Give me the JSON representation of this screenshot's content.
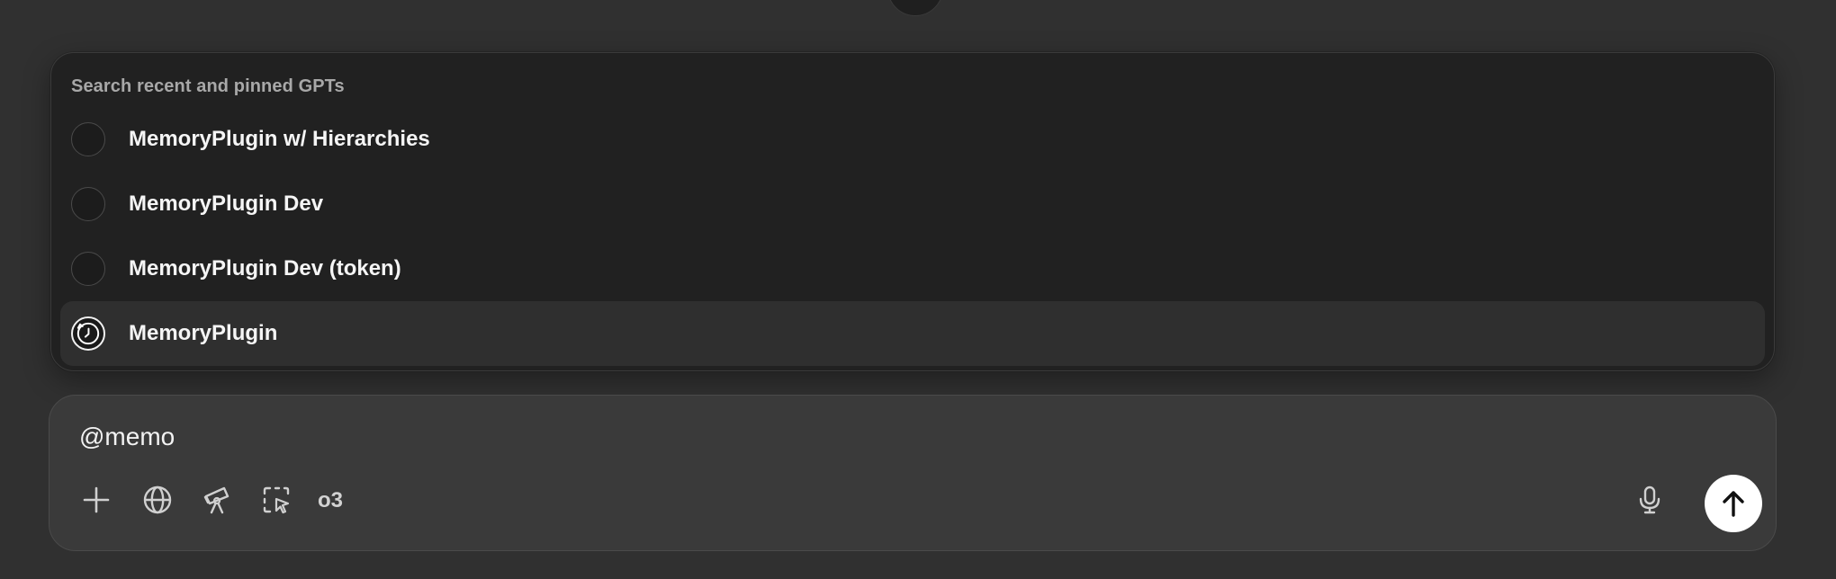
{
  "popup": {
    "heading": "Search recent and pinned GPTs",
    "items": [
      {
        "label": "MemoryPlugin w/ Hierarchies",
        "avatar": "empty-circle-avatar",
        "active": false
      },
      {
        "label": "MemoryPlugin Dev",
        "avatar": "empty-circle-avatar",
        "active": false
      },
      {
        "label": "MemoryPlugin Dev (token)",
        "avatar": "empty-circle-avatar",
        "active": false
      },
      {
        "label": "MemoryPlugin",
        "avatar": "clock-logo-avatar",
        "active": true
      }
    ]
  },
  "composer": {
    "value": "@memo",
    "model": "o3",
    "tools": [
      "plus-icon",
      "globe-icon",
      "telescope-icon",
      "cursor-select-icon"
    ],
    "mic": "microphone-icon",
    "send": "arrow-up-icon"
  },
  "colors": {
    "background": "#303030",
    "popup": "#212121",
    "active_row": "#2f2f2f",
    "composer": "#3a3a3a",
    "send_button": "#ffffff"
  }
}
